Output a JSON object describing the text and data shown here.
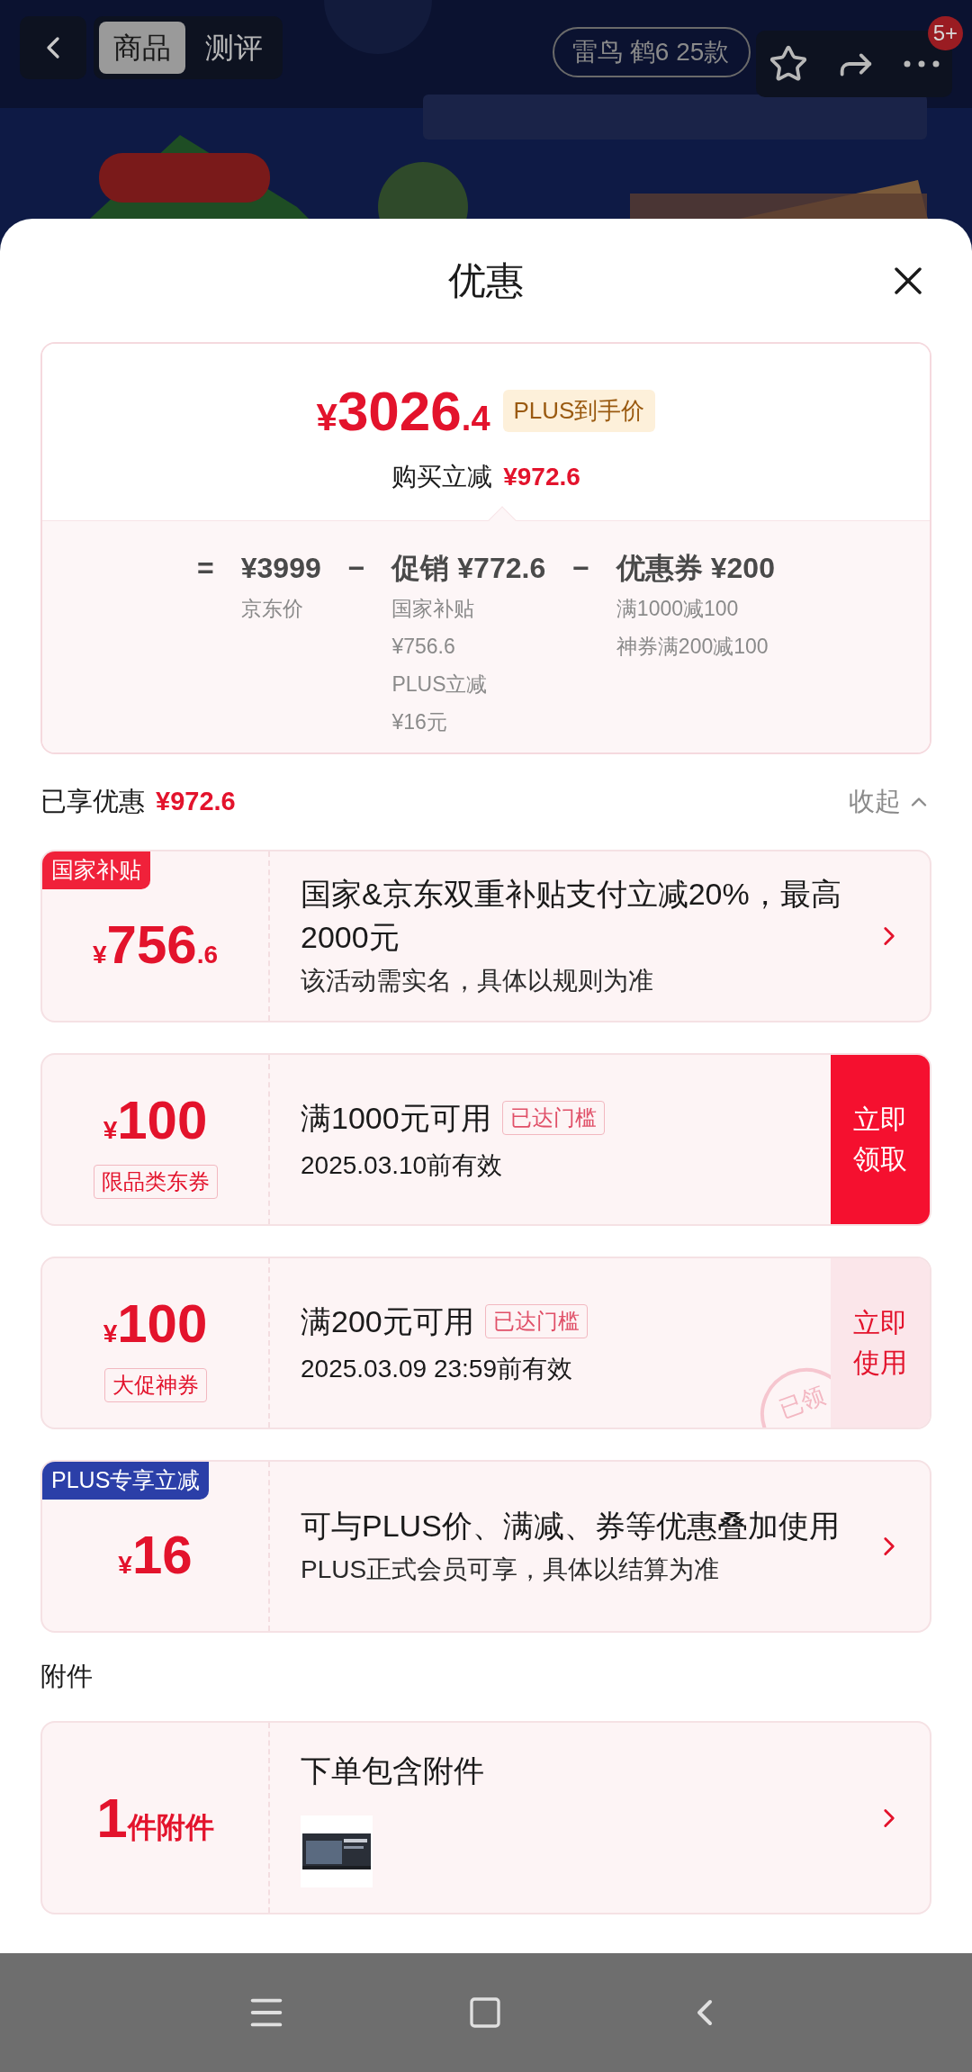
{
  "top_bar": {
    "tabs": [
      {
        "label": "商品",
        "selected": true
      },
      {
        "label": "测评",
        "selected": false
      }
    ],
    "search": {
      "value": "雷鸟 鹤6 25款"
    },
    "badge": "5+"
  },
  "sheet": {
    "title": "优惠",
    "summary": {
      "price": {
        "currency": "¥",
        "integer": "3026",
        "decimal": ".4"
      },
      "price_tag": "PLUS到手价",
      "reduction_label": "购买立减",
      "reduction": "¥972.6",
      "terms": [
        {
          "operator": "=",
          "heading": "¥3999",
          "details": [
            "京东价"
          ]
        },
        {
          "operator": "−",
          "heading": "促销 ¥772.6",
          "details": [
            "国家补贴",
            "¥756.6",
            "PLUS立减",
            "¥16元"
          ]
        },
        {
          "operator": "−",
          "heading": "优惠券 ¥200",
          "details": [
            "满1000减100",
            "神券满200减100"
          ]
        }
      ]
    },
    "section": {
      "label": "已享优惠",
      "amount": "¥972.6",
      "toggle": "收起",
      "expanded": true
    },
    "offers": [
      {
        "kind": "offer",
        "tag": "国家补贴",
        "color": "#f0213a",
        "currency": "¥",
        "amount": "756",
        "decimal": ".6",
        "title": "国家&京东双重补贴支付立减20%，最高2000元",
        "note": "该活动需实名，具体以规则为准"
      },
      {
        "kind": "coupon",
        "currency": "¥",
        "amount": "100",
        "label": "限品类东券",
        "title": "满1000元可用",
        "badge": "已达门槛",
        "validity": "2025.03.10前有效",
        "action": "立即领取",
        "claimed": false
      },
      {
        "kind": "coupon",
        "currency": "¥",
        "amount": "100",
        "label": "大促神券",
        "title": "满200元可用",
        "badge": "已达门槛",
        "validity": "2025.03.09 23:59前有效",
        "action": "立即使用",
        "claimed": true,
        "stamp": "已领"
      },
      {
        "kind": "offer",
        "tag": "PLUS专享立减",
        "color": "#2b3fa8",
        "currency": "¥",
        "amount": "16",
        "title": "可与PLUS价、满减、券等优惠叠加使用",
        "note": "PLUS正式会员可享，具体以结算为准"
      }
    ],
    "attachments": {
      "label": "附件",
      "count": "1",
      "unit": "件附件",
      "title": "下单包含附件"
    }
  }
}
